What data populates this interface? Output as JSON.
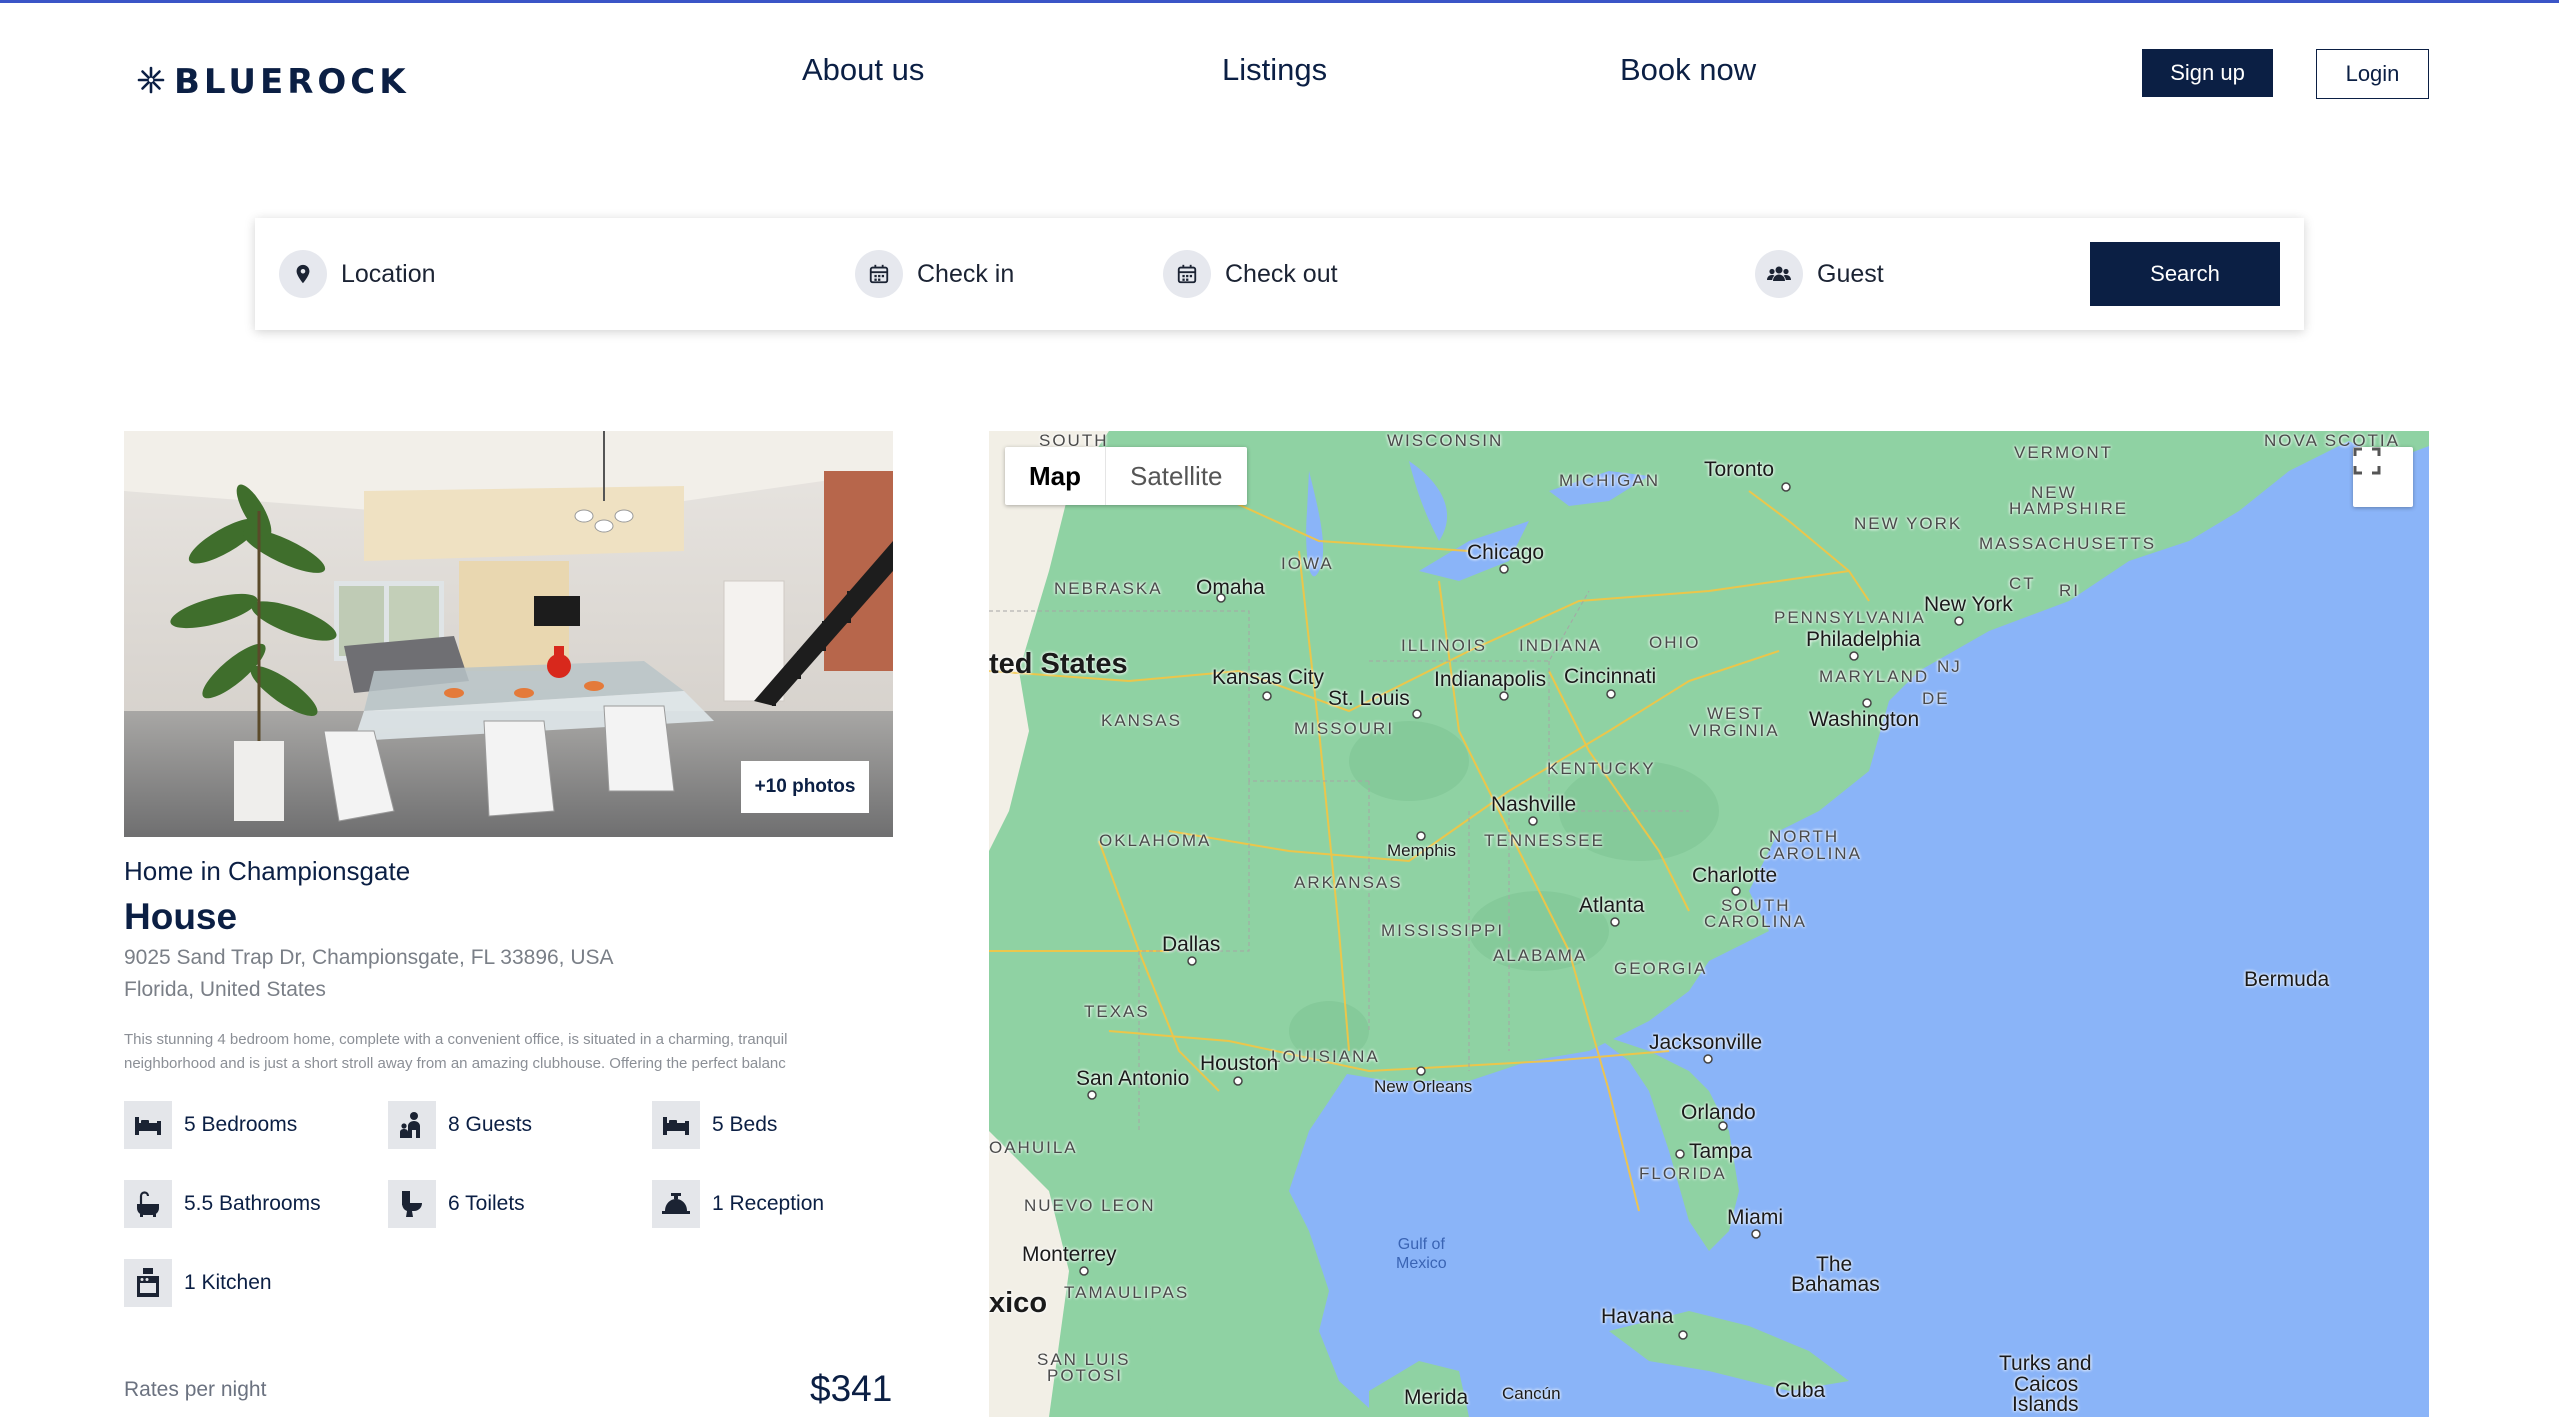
{
  "header": {
    "logo_text": "BLUEROCK",
    "nav": [
      "About us",
      "Listings",
      "Book now"
    ],
    "signup_label": "Sign up",
    "login_label": "Login"
  },
  "search": {
    "location_label": "Location",
    "checkin_label": "Check in",
    "checkout_label": "Check out",
    "guest_label": "Guest",
    "search_button": "Search"
  },
  "listing": {
    "photos_badge": "+10 photos",
    "subtitle": "Home in Championsgate",
    "title": "House",
    "address_line1": "9025 Sand Trap Dr, Championsgate, FL 33896, USA",
    "address_line2": "Florida, United States",
    "description_line1": "This stunning 4 bedroom home, complete with a convenient office, is situated in a charming, tranquil",
    "description_line2": "neighborhood and is just a short stroll away from an amazing clubhouse. Offering the perfect balanc",
    "amenities": [
      {
        "icon": "bed-icon",
        "label": "5 Bedrooms"
      },
      {
        "icon": "guests-icon",
        "label": "8 Guests"
      },
      {
        "icon": "bed-icon",
        "label": "5 Beds"
      },
      {
        "icon": "bathtub-icon",
        "label": "5.5 Bathrooms"
      },
      {
        "icon": "toilet-icon",
        "label": "6 Toilets"
      },
      {
        "icon": "reception-bell-icon",
        "label": "1 Reception"
      },
      {
        "icon": "kitchen-icon",
        "label": "1 Kitchen"
      }
    ],
    "rates_label": "Rates per night",
    "price": "$341"
  },
  "map": {
    "toggle_map": "Map",
    "toggle_satellite": "Satellite",
    "state_labels": [
      "SOUTH",
      "WISCONSIN",
      "MICHIGAN",
      "VERMONT",
      "NOVA SCOTIA",
      "NEW",
      "HAMPSHIRE",
      "NEW YORK",
      "MASSACHUSETTS",
      "CT",
      "RI",
      "NEBRASKA",
      "IOWA",
      "ILLINOIS",
      "INDIANA",
      "OHIO",
      "PENNSYLVANIA",
      "NJ",
      "MARYLAND",
      "DE",
      "KANSAS",
      "MISSOURI",
      "WEST",
      "VIRGINIA",
      "KENTUCKY",
      "OKLAHOMA",
      "TENNESSEE",
      "NORTH",
      "CAROLINA",
      "ARKANSAS",
      "MISSISSIPPI",
      "ALABAMA",
      "GEORGIA",
      "SOUTH",
      "CAROLINA",
      "TEXAS",
      "LOUISIANA",
      "FLORIDA",
      "OAHUILA",
      "NUEVO LEON",
      "TAMAULIPAS",
      "SAN LUIS",
      "POTOSI"
    ],
    "city_labels": [
      "Toronto",
      "Chicago",
      "Omaha",
      "New York",
      "Philadelphia",
      "Kansas City",
      "St. Louis",
      "Indianapolis",
      "Cincinnati",
      "Washington",
      "Nashville",
      "Memphis",
      "Charlotte",
      "Atlanta",
      "Dallas",
      "Houston",
      "San Antonio",
      "New Orleans",
      "Jacksonville",
      "Orlando",
      "Tampa",
      "Miami",
      "Monterrey",
      "Havana",
      "Cuba",
      "Merida",
      "Cancún",
      "Bermuda",
      "The",
      "Bahamas",
      "Turks and",
      "Caicos",
      "Islands"
    ],
    "country_labels": [
      "ted States",
      "xico"
    ],
    "water_labels": [
      "Gulf of",
      "Mexico"
    ]
  },
  "colors": {
    "brand_navy": "#0b1f44",
    "accent_line": "#3b55c7",
    "map_water": "#8ab4f8",
    "map_land": "#8fd2a3"
  }
}
